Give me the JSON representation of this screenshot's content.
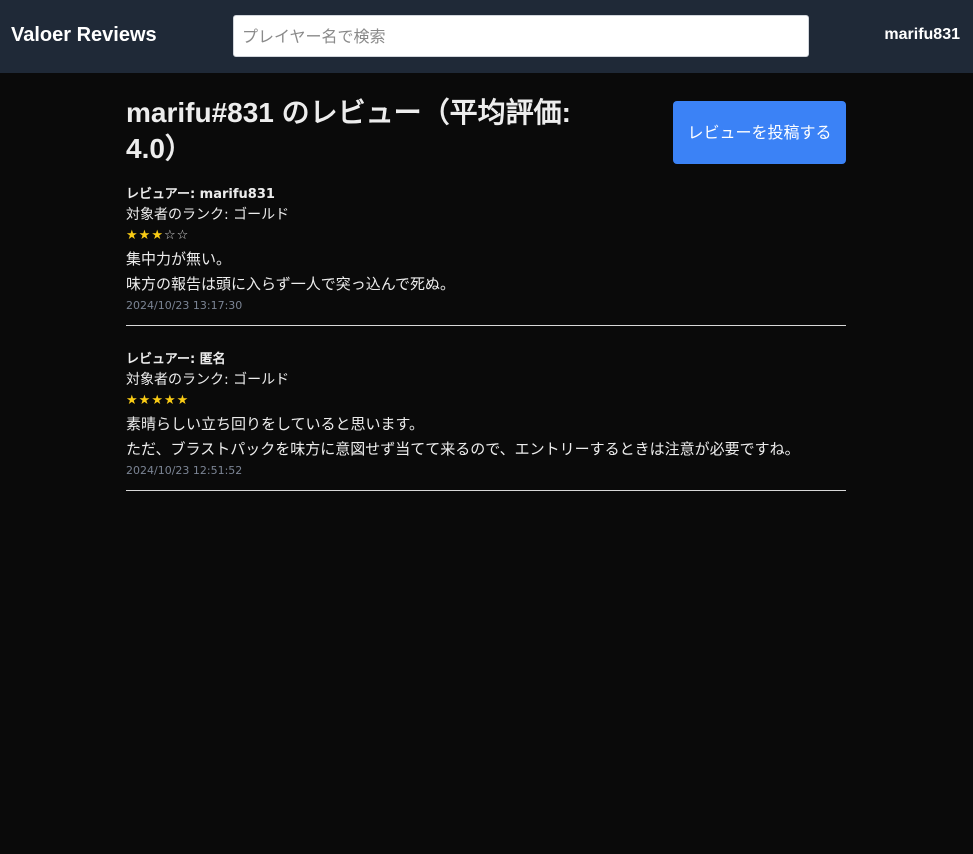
{
  "header": {
    "brand": "Valoer Reviews",
    "search_placeholder": "プレイヤー名で検索",
    "search_value": "",
    "username": "marifu831"
  },
  "page": {
    "title": "marifu#831 のレビュー（平均評価: 4.0）",
    "post_button": "レビューを投稿する"
  },
  "reviews": [
    {
      "reviewer": "レビュアー: marifu831",
      "rank": "対象者のランク: ゴールド",
      "rating": 3,
      "max_rating": 5,
      "lines": [
        "集中力が無い。",
        "味方の報告は頭に入らず一人で突っ込んで死ぬ。"
      ],
      "date": "2024/10/23 13:17:30"
    },
    {
      "reviewer": "レビュアー: 匿名",
      "rank": "対象者のランク: ゴールド",
      "rating": 5,
      "max_rating": 5,
      "lines": [
        "素晴らしい立ち回りをしていると思います。",
        "ただ、ブラストパックを味方に意図せず当てて来るので、エントリーするときは注意が必要ですね。"
      ],
      "date": "2024/10/23 12:51:52"
    }
  ],
  "colors": {
    "accent": "#3b82f6",
    "star": "#facc15",
    "header_bg": "#1f2937",
    "page_bg": "#0a0a0a"
  }
}
